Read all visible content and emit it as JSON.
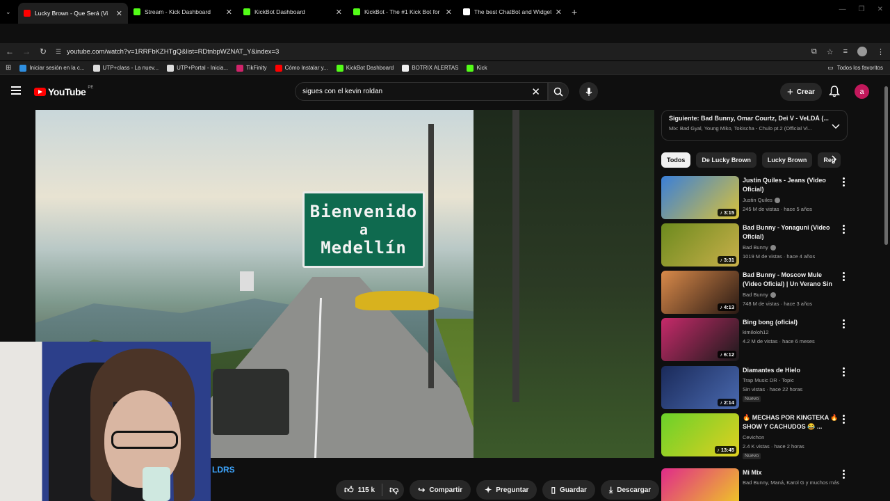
{
  "browser": {
    "tabs": [
      {
        "title": "Lucky Brown - Que Será (Vi",
        "color": "#ff0000",
        "active": true
      },
      {
        "title": "Stream - Kick Dashboard",
        "color": "#53fc18",
        "active": false
      },
      {
        "title": "KickBot Dashboard",
        "color": "#53fc18",
        "active": false
      },
      {
        "title": "KickBot - The #1 Kick Bot for C",
        "color": "#53fc18",
        "active": false
      },
      {
        "title": "The best ChatBot and Widgets",
        "color": "#ffffff",
        "active": false
      }
    ],
    "url": "youtube.com/watch?v=1RRFbKZHTgQ&list=RDtnbpWZNAT_Y&index=3",
    "bookmarks": [
      {
        "label": "Iniciar sesión en la c...",
        "icon": "windows-icon"
      },
      {
        "label": "UTP+class - La nuev...",
        "icon": "page-icon"
      },
      {
        "label": "UTP+Portal - Inicia...",
        "icon": "page-icon"
      },
      {
        "label": "TikFinity",
        "icon": "tikfinity-icon"
      },
      {
        "label": "Cómo Instalar y...",
        "icon": "youtube-icon"
      },
      {
        "label": "KickBot Dashboard",
        "icon": "kickbot-icon"
      },
      {
        "label": "BOTRIX ALERTAS",
        "icon": "botrix-icon"
      },
      {
        "label": "Kick",
        "icon": "kick-icon"
      }
    ],
    "all_bookmarks": "Todos los favoritos"
  },
  "youtube": {
    "logo_text": "YouTube",
    "region": "PE",
    "search_query": "sigues con el kevin roldan",
    "create_label": "Crear",
    "account_initial": "a"
  },
  "video": {
    "sign_line1": "Bienvenido",
    "sign_line2": "a",
    "sign_line3": "Medellín",
    "channel_fragment": "LDRS"
  },
  "actions": {
    "likes": "115 k",
    "share": "Compartir",
    "ask": "Preguntar",
    "save": "Guardar",
    "download": "Descargar"
  },
  "sidebar": {
    "next_title": "Siguiente: Bad Bunny, Omar Courtz, Dei V - VeLDÁ (...",
    "next_sub": "Mix: Bad Gyal, Young Miko, Tokischa - Chulo pt.2 (Official Vi...",
    "chips": [
      "Todos",
      "De Lucky Brown",
      "Lucky Brown",
      "Reg"
    ],
    "items": [
      {
        "title": "Justin Quiles - Jeans (Video Oficial)",
        "channel": "Justin Quiles",
        "verified": true,
        "meta": "245 M de vistas · hace 5 años",
        "duration": "3:15",
        "badge": "",
        "c1": "#3a7fd8",
        "c2": "#d9c23a"
      },
      {
        "title": "Bad Bunny - Yonaguni (Video Oficial)",
        "channel": "Bad Bunny",
        "verified": true,
        "meta": "1019 M de vistas · hace 4 años",
        "duration": "3:31",
        "badge": "",
        "c1": "#6c8a1e",
        "c2": "#c9b04a"
      },
      {
        "title": "Bad Bunny - Moscow Mule (Video Oficial) | Un Verano Sin ...",
        "channel": "Bad Bunny",
        "verified": true,
        "meta": "748 M de vistas · hace 3 años",
        "duration": "4:13",
        "badge": "",
        "c1": "#d98a4a",
        "c2": "#2a1a14"
      },
      {
        "title": "Bing bong (oficial)",
        "channel": "kimiloloh12",
        "verified": false,
        "meta": "4.2 M de vistas · hace 6 meses",
        "duration": "6:12",
        "badge": "",
        "c1": "#c72a6a",
        "c2": "#1a1a1a"
      },
      {
        "title": "Diamantes de Hielo",
        "channel": "Trap Music DR - Topic",
        "verified": false,
        "meta": "Sin vistas · hace 22 horas",
        "duration": "2:14",
        "badge": "Nuevo",
        "c1": "#1a2a5a",
        "c2": "#4a6ab0"
      },
      {
        "title": "🔥 MECHAS POR KINGTEKA 🔥 SHOW Y CACHUDOS 😂 ...",
        "channel": "Cevichon",
        "verified": false,
        "meta": "2.4 K vistas · hace 2 horas",
        "duration": "13:45",
        "badge": "Nuevo",
        "c1": "#6ad12a",
        "c2": "#e0d020"
      },
      {
        "title": "Mi Mix",
        "channel": "Bad Bunny, Maná, Karol G y muchos más",
        "verified": false,
        "meta": "",
        "duration": "",
        "badge": "",
        "c1": "#e02a8a",
        "c2": "#f0d020"
      }
    ]
  }
}
